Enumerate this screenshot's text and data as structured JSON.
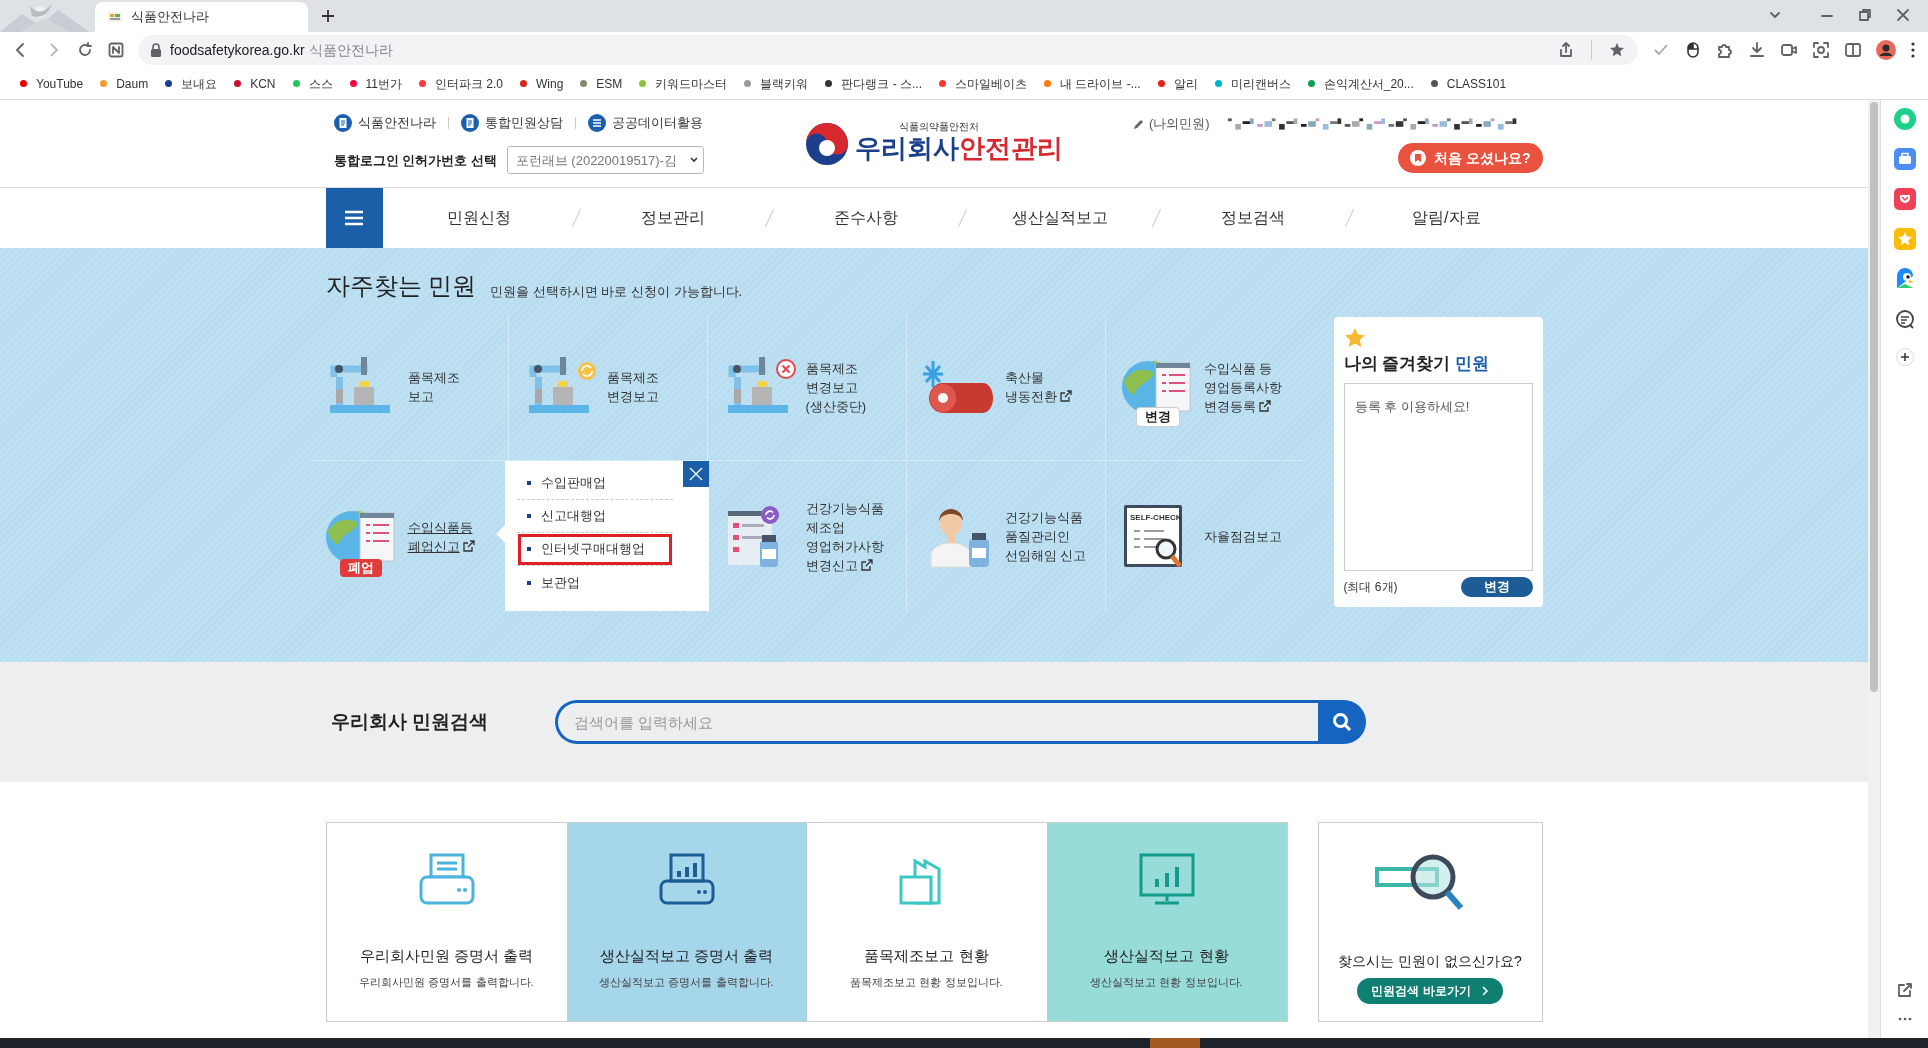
{
  "browser": {
    "tabs": [
      {
        "title": "식품안전나라",
        "selected": true
      }
    ],
    "address": {
      "domain": "foodsafetykorea.go.kr",
      "page_title": "식품안전나라"
    },
    "bookmarks": [
      {
        "label": "YouTube",
        "color": "#ee0000"
      },
      {
        "label": "Daum",
        "color": "#f39c32"
      },
      {
        "label": "보내요",
        "color": "#1c3f94"
      },
      {
        "label": "KCN",
        "color": "#c8102e"
      },
      {
        "label": "스스",
        "color": "#1dc75f"
      },
      {
        "label": "11번가",
        "color": "#f2073a"
      },
      {
        "label": "인터파크 2.0",
        "color": "#f43a3a"
      },
      {
        "label": "Wing",
        "color": "#d4291a"
      },
      {
        "label": "ESM",
        "color": "#8a8a6a"
      },
      {
        "label": "키워드마스터",
        "color": "#8fc13e"
      },
      {
        "label": "블랙키워",
        "color": "#999999"
      },
      {
        "label": "판다랭크 - 스...",
        "color": "#333333"
      },
      {
        "label": "스마일베이츠",
        "color": "#ff3333"
      },
      {
        "label": "내 드라이브 -...",
        "color": "#ff7b00"
      },
      {
        "label": "알리",
        "color": "#e2231a"
      },
      {
        "label": "미리캔버스",
        "color": "#00b4c8"
      },
      {
        "label": "손익계산서_20...",
        "color": "#0f9d58"
      },
      {
        "label": "CLASS101",
        "color": "#555555"
      }
    ]
  },
  "header": {
    "top_links": [
      "식품안전나라",
      "통합민원상담",
      "공공데이터활용"
    ],
    "login_label": "통합로그인 인허가번호 선택",
    "license_select": "포런래브 (20220019517)-김",
    "logo": {
      "agency": "식품의약품안전처",
      "name": "우리회사",
      "name_accent": "안전관리"
    },
    "my_complaints": "(나의민원)",
    "first_visit_button": "처음 오셨나요?"
  },
  "nav": {
    "items": [
      "민원신청",
      "정보관리",
      "준수사항",
      "생산실적보고",
      "정보검색",
      "알림/자료"
    ]
  },
  "frequent": {
    "title": "자주찾는 민원",
    "subtitle": "민원을 선택하시면 바로 신청이 가능합니다.",
    "tiles": [
      {
        "kind": "tile",
        "label": "품목제조\n보고",
        "external": false,
        "underlined": false
      },
      {
        "kind": "tile",
        "label": "품목제조\n변경보고",
        "external": false,
        "underlined": false
      },
      {
        "kind": "tile",
        "label": "품목제조\n변경보고\n(생산중단)",
        "external": false,
        "underlined": false
      },
      {
        "kind": "tile",
        "label": "축산물\n냉동전환",
        "external": true,
        "underlined": false
      },
      {
        "kind": "tile",
        "label": "수입식품 등\n영업등록사항\n변경등록",
        "external": true,
        "underlined": false,
        "badge": {
          "label": "변경",
          "color": "#ffffff"
        }
      },
      {
        "kind": "tile",
        "label": "수입식품등\n폐업신고",
        "external": true,
        "underlined": true,
        "badge": {
          "label": "폐업",
          "color": "#e03c3c"
        }
      },
      {
        "kind": "menu",
        "items": [
          {
            "label": "수입판매업",
            "highlighted": false
          },
          {
            "label": "신고대행업",
            "highlighted": false
          },
          {
            "label": "인터넷구매대행업",
            "highlighted": true
          },
          {
            "label": "보관업",
            "highlighted": false
          }
        ]
      },
      {
        "kind": "tile",
        "label": "건강기능식품\n제조업\n영업허가사항\n변경신고",
        "external": true,
        "underlined": false
      },
      {
        "kind": "tile",
        "label": "건강기능식품\n품질관리인\n선임해임 신고",
        "external": false,
        "underlined": false
      },
      {
        "kind": "tile",
        "label": "자율점검보고",
        "external": false,
        "underlined": false,
        "icon_text": "SELF-CHECK"
      }
    ]
  },
  "favorites": {
    "title": "나의 즐겨찾기",
    "title_accent": "민원",
    "empty_message": "등록 후 이용하세요!",
    "limit": "(최대 6개)",
    "button": "변경"
  },
  "search": {
    "label": "우리회사 민원검색",
    "placeholder": "검색어를 입력하세요"
  },
  "cards": [
    {
      "kind": "white",
      "title": "우리회사민원 증명서 출력",
      "description": "우리회사민원 증명서를 출력합니다."
    },
    {
      "kind": "blue",
      "title": "생산실적보고 증명서 출력",
      "description": "생산실적보고 증명서를 출력합니다."
    },
    {
      "kind": "white",
      "title": "품목제조보고 현황",
      "description": "품목제조보고 현황 정보입니다."
    },
    {
      "kind": "teal",
      "title": "생산실적보고 현황",
      "description": "생산실적보고 현황 정보입니다."
    }
  ],
  "help": {
    "question": "찾으시는 민원이 없으신가요?",
    "button": "민원검색 바로가기"
  }
}
